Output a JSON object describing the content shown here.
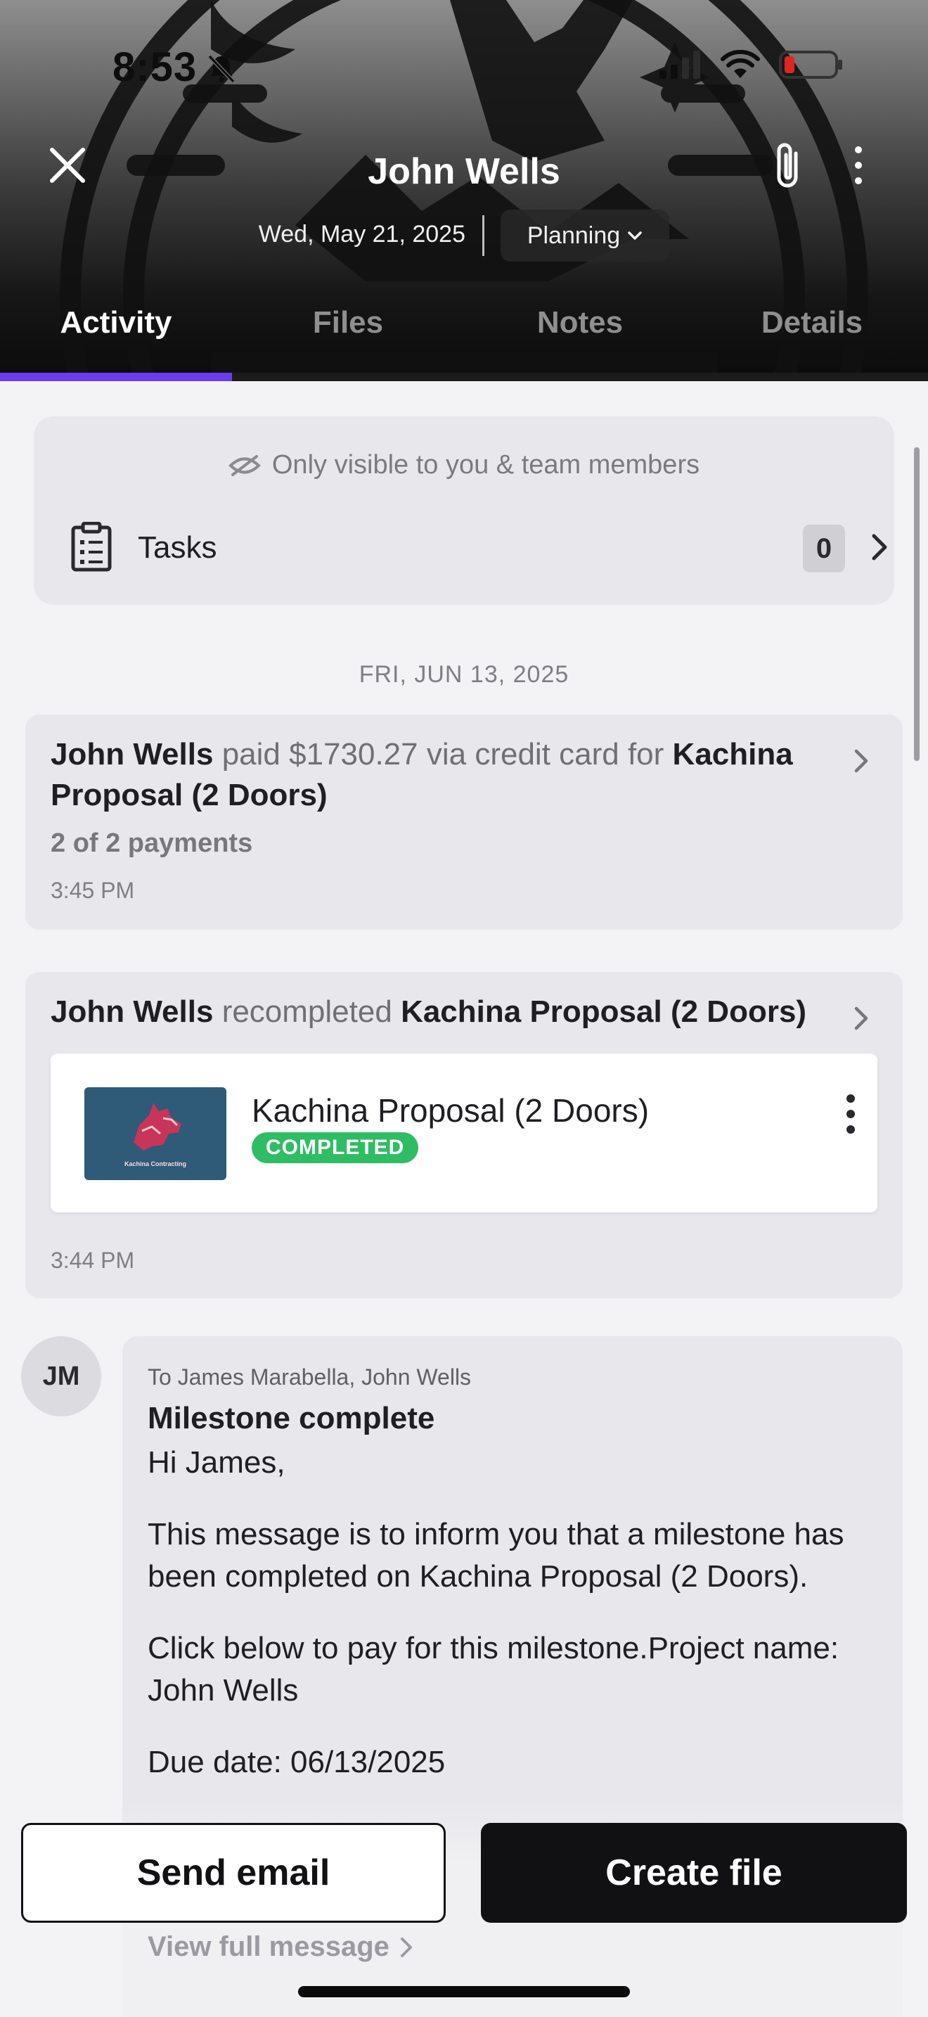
{
  "status_bar": {
    "time": "8:53"
  },
  "header": {
    "title": "John Wells",
    "date": "Wed, May 21, 2025",
    "stage": "Planning",
    "tabs": [
      {
        "label": "Activity",
        "active": true
      },
      {
        "label": "Files",
        "active": false
      },
      {
        "label": "Notes",
        "active": false
      },
      {
        "label": "Details",
        "active": false
      }
    ]
  },
  "tasks_card": {
    "visibility_note": "Only visible to you & team members",
    "label": "Tasks",
    "count": "0"
  },
  "timeline": {
    "date_header": "FRI, JUN 13, 2025",
    "payment": {
      "actor": "John Wells",
      "verb": "paid $1730.27 via credit card for",
      "object": "Kachina Proposal (2 Doors)",
      "progress": "2 of 2 payments",
      "time": "3:45 PM"
    },
    "recompleted": {
      "actor": "John Wells",
      "verb": "recompleted",
      "object": "Kachina Proposal (2 Doors)",
      "file_title": "Kachina Proposal (2 Doors)",
      "badge": "COMPLETED",
      "thumb_caption": "Kachina Contracting",
      "time": "3:44 PM"
    },
    "message": {
      "initials": "JM",
      "to": "To James Marabella, John Wells",
      "subject": "Milestone complete",
      "greeting": "Hi James,",
      "para1": "This message is to inform you that a milestone has been completed on Kachina Proposal (2 Doors).",
      "para2": "Click below to pay for this milestone.Project name: John Wells",
      "para3": "Due date: 06/13/2025",
      "view_full": "View full message"
    }
  },
  "actions": {
    "send_email": "Send email",
    "create_file": "Create file"
  },
  "colors": {
    "accent": "#6a3df0",
    "completed": "#2fbd63",
    "primary_button": "#111113"
  }
}
